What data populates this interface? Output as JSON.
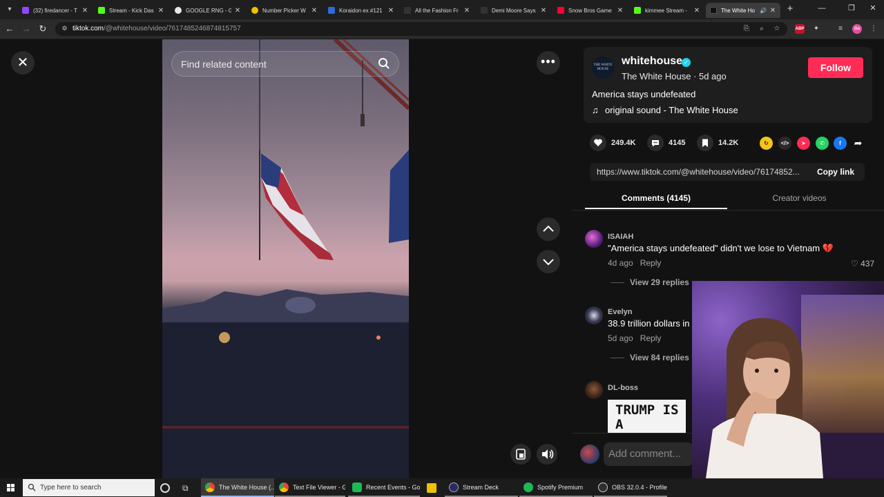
{
  "browser": {
    "tabs": [
      {
        "label": "(32) firedancer - T",
        "color": "#9146ff"
      },
      {
        "label": "Stream - Kick Das",
        "color": "#53fc18"
      },
      {
        "label": "GOOGLE RNG - G",
        "color": "#e8e8e8"
      },
      {
        "label": "Number Picker W",
        "color": "#f0c000"
      },
      {
        "label": "Koraidon ex #121",
        "color": "#2e6bd6"
      },
      {
        "label": "All the Fashion Fr",
        "color": "#222222"
      },
      {
        "label": "Demi Moore Says",
        "color": "#222222"
      },
      {
        "label": "Snow Bros Game",
        "color": "#ff0033"
      },
      {
        "label": "kimmee Stream -",
        "color": "#53fc18"
      },
      {
        "label": "The White Ho",
        "color": "#111111",
        "active": true
      }
    ],
    "url_domain": "tiktok.com",
    "url_path": "/@whitehouse/video/7617485246874815757"
  },
  "video": {
    "search_placeholder": "Find related content"
  },
  "author": {
    "username": "whitehouse",
    "display_name": "The White House",
    "time_ago": "5d ago",
    "subline": "The White House · 5d ago",
    "follow_label": "Follow",
    "avatar_text": "THE WHITE HOUSE"
  },
  "post": {
    "description": "America stays undefeated",
    "music": "original sound - The White House"
  },
  "stats": {
    "likes": "249.4K",
    "comments": "4145",
    "saves": "14.2K"
  },
  "share": {
    "link": "https://www.tiktok.com/@whitehouse/video/76174852...",
    "copy_label": "Copy link"
  },
  "comment_tabs": {
    "comments": "Comments (4145)",
    "creator": "Creator videos"
  },
  "comments": [
    {
      "user": "ISAIAH",
      "text": "\"America stays undefeated\" didn't we lose to Vietnam 💔",
      "ago": "4d ago",
      "reply": "Reply",
      "likes": "437",
      "view_replies": "View 29 replies"
    },
    {
      "user": "Evelyn",
      "text": "38.9 trillion dollars in",
      "ago": "5d ago",
      "reply": "Reply",
      "view_replies": "View 84 replies"
    },
    {
      "user": "DL-boss",
      "image_text": "TRUMP IS A"
    }
  ],
  "add_comment": {
    "placeholder": "Add comment..."
  },
  "taskbar": {
    "search_placeholder": "Type here to search",
    "apps": [
      {
        "label": "The White House (...",
        "color": "#4285f4"
      },
      {
        "label": "Text File Viewer - G...",
        "color": "#4285f4"
      },
      {
        "label": "Recent Events - Go...",
        "color": "#1db954"
      },
      {
        "label": "",
        "color": "#f0c000"
      },
      {
        "label": "Stream Deck",
        "color": "#2a2a6a"
      },
      {
        "label": "Spotify Premium",
        "color": "#1db954"
      },
      {
        "label": "OBS 32.0.4 - Profile:...",
        "color": "#302e31"
      }
    ]
  }
}
